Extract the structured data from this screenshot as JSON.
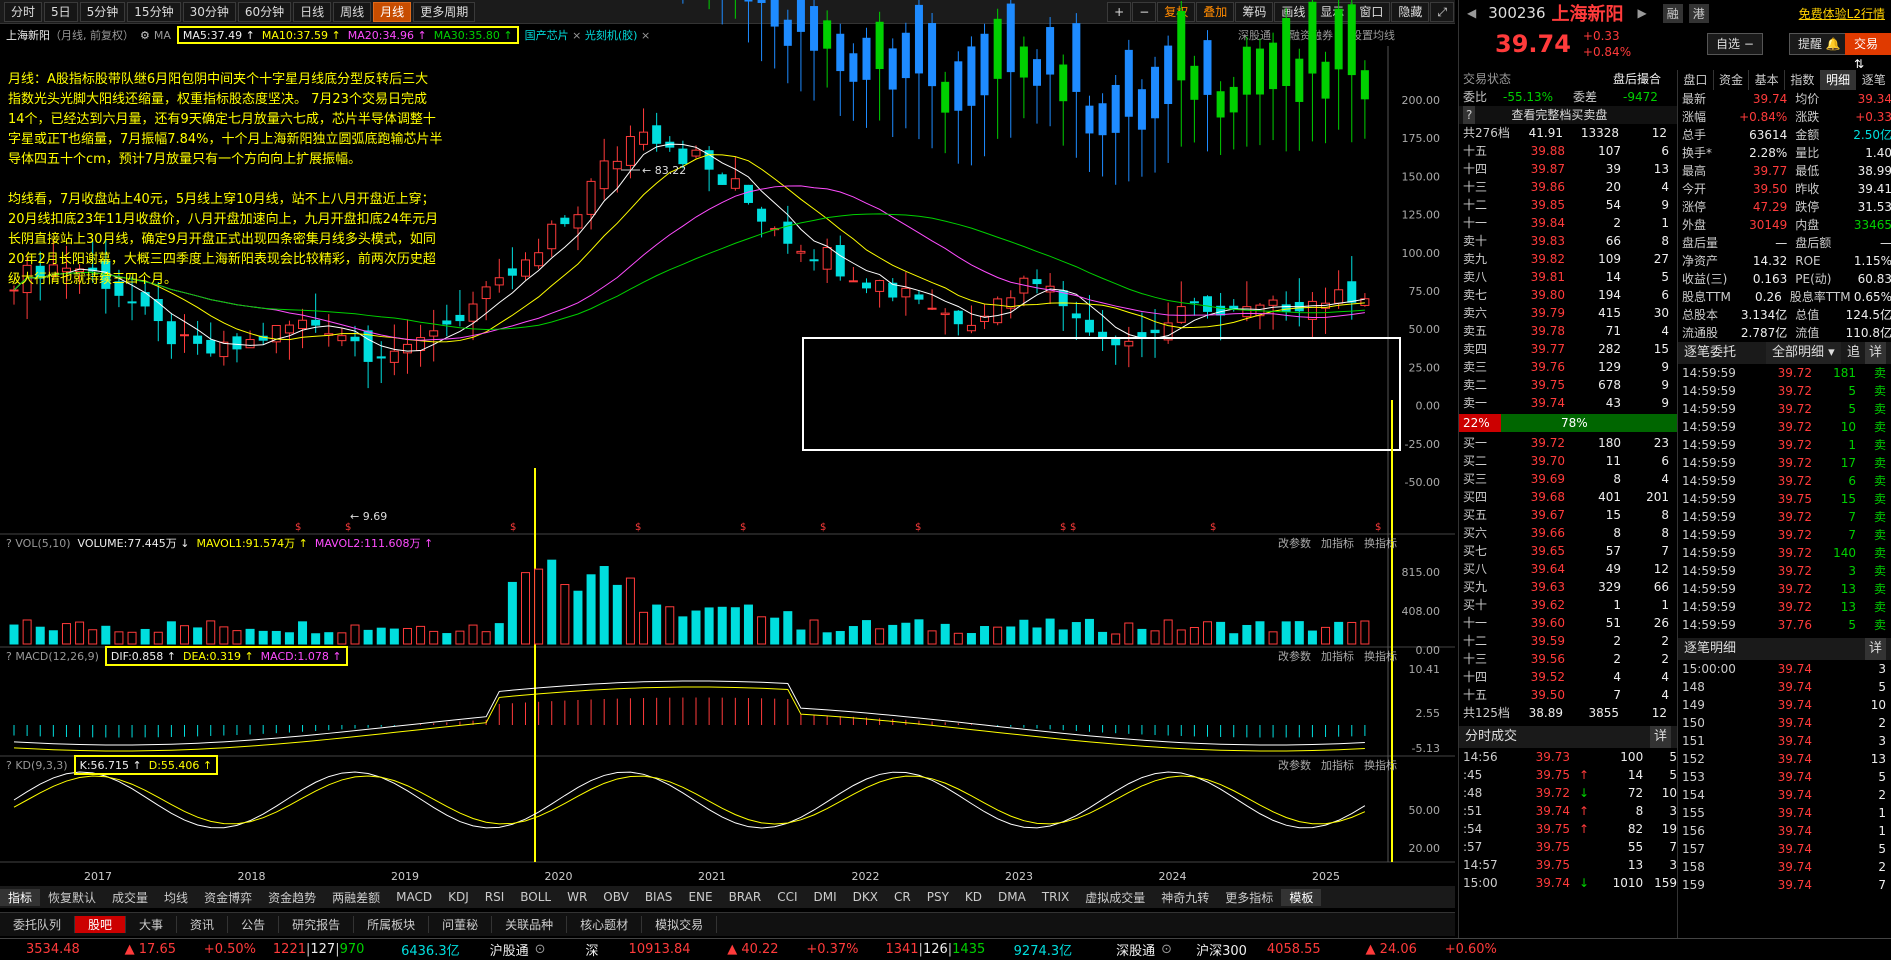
{
  "toolbar": {
    "periods": [
      "分时",
      "5日",
      "5分钟",
      "15分钟",
      "30分钟",
      "60分钟",
      "日线",
      "周线",
      "月线",
      "更多周期"
    ],
    "active": "月线",
    "right": [
      "+",
      "−",
      "复权",
      "叠加",
      "筹码",
      "画线",
      "显示",
      "窗口",
      "隐藏"
    ]
  },
  "chart_header": {
    "name": "上海新阳",
    "sub": "（月线, 前复权）",
    "ma_prefix": "MA",
    "ma5": "MA5:37.49 ↑",
    "ma10": "MA10:37.59 ↑",
    "ma20": "MA20:34.96 ↑",
    "ma30": "MA30:35.80 ↑",
    "tags": [
      "国产芯片",
      "光刻机(胶)"
    ],
    "links": [
      "深股通",
      "融资融券",
      "设置均线"
    ]
  },
  "note1": "月线：A股指标股带队继6月阳包阴中间夹个十字星月线底分型反转后三大\n指数光头光脚大阳线还缩量，权重指标股态度坚决。 7月23个交易日完成\n14个，已经达到六月量，还有9天确定七月放量六七成，芯片半导体调整十\n字星或正T也缩量，7月振幅7.84%，十个月上海新阳独立圆弧底跑输芯片半\n导体四五十个cm，预计7月放量只有一个方向向上扩展振幅。",
  "note2": "均线看，7月收盘站上40元，5月线上穿10月线，站不上八月开盘近上穿；\n20月线扣底23年11月收盘价，八月开盘加速向上，九月开盘扣底24年元月\n长阴直接站上30月线，确定9月开盘正式出现四条密集月线多头模式，如同\n20年2月长阳谢幕，大概三四季度上海新阳表现会比较精彩，前两次历史超\n级大行情也就持续三四个月。",
  "price_axis": [
    "200.00",
    "175.00",
    "150.00",
    "125.00",
    "100.00",
    "75.00",
    "50.00",
    "25.00",
    "0.00",
    "-25.00",
    "-50.00"
  ],
  "labels": {
    "high": "83.22",
    "low": "9.69"
  },
  "vol": {
    "title": "VOL(5,10)",
    "volume": "VOLUME:77.445万 ↓",
    "mavol1": "MAVOL1:91.574万 ↑",
    "mavol2": "MAVOL2:111.608万 ↑",
    "axis": [
      "815.00",
      "408.00",
      "0.00"
    ]
  },
  "macd": {
    "title": "MACD(12,26,9)",
    "dif": "DIF:0.858 ↑",
    "dea": "DEA:0.319 ↑",
    "macd": "MACD:1.078 ↑",
    "axis": [
      "10.41",
      "2.55",
      "-5.13"
    ]
  },
  "kd": {
    "title": "KD(9,3,3)",
    "k": "K:56.715 ↑",
    "d": "D:55.406 ↑",
    "axis": [
      "50.00",
      "20.00"
    ]
  },
  "ind_links": [
    "改参数",
    "加指标",
    "换指标"
  ],
  "years": [
    "2017",
    "2018",
    "2019",
    "2020",
    "2021",
    "2022",
    "2023",
    "2024",
    "2025"
  ],
  "func_tabs": [
    "指标",
    "恢复默认",
    "成交量",
    "均线",
    "资金博弈",
    "资金趋势",
    "两融差额",
    "MACD",
    "KDJ",
    "RSI",
    "BOLL",
    "WR",
    "OBV",
    "BIAS",
    "ENE",
    "BRAR",
    "CCI",
    "DMI",
    "DKX",
    "CR",
    "PSY",
    "KD",
    "DMA",
    "TRIX",
    "虚拟成交量",
    "神奇九转",
    "更多指标",
    "模板"
  ],
  "bottom_tabs": [
    "委托队列",
    "股吧",
    "大事",
    "资讯",
    "公告",
    "研究报告",
    "所属板块",
    "问董秘",
    "关联品种",
    "核心题材",
    "模拟交易"
  ],
  "status": {
    "sh": "3534.48",
    "sh_chg": "▲ 17.65",
    "sh_pct": "+0.50%",
    "sh_adv": "1221",
    "sh_flat": "127",
    "sh_dec": "970",
    "sh_amt": "6436.3亿",
    "hgt": "沪股通",
    "sz_label": "深",
    "sz": "10913.84",
    "sz_chg": "▲ 40.22",
    "sz_pct": "+0.37%",
    "sz_adv": "1341",
    "sz_flat": "126",
    "sz_dec": "1435",
    "sz_amt": "9274.3亿",
    "sgt": "深股通",
    "hs_label": "沪深300",
    "hs": "4058.55",
    "hs_chg": "▲ 24.06",
    "hs_pct": "+0.60%"
  },
  "stock": {
    "code": "300236",
    "name": "上海新阳",
    "price": "39.74",
    "chg": "+0.33",
    "pct": "+0.84%",
    "btns": [
      "融",
      "港"
    ],
    "free": "免费体验L2行情",
    "zx": "自选",
    "tx": "提醒",
    "jy": "交易"
  },
  "status_left": {
    "label": "交易状态",
    "val": "盘后撮合",
    "wb_label": "委比",
    "wb": "-55.13%",
    "wc_label": "委差",
    "wc": "-9472",
    "full": "查看完整档买卖盘",
    "total_label": "共276档",
    "total_price": "41.91",
    "total_vol": "13328",
    "total_n": "12"
  },
  "asks": [
    [
      "十五",
      "39.88",
      "107",
      "6"
    ],
    [
      "十四",
      "39.87",
      "39",
      "13"
    ],
    [
      "十三",
      "39.86",
      "20",
      "4"
    ],
    [
      "十二",
      "39.85",
      "54",
      "9"
    ],
    [
      "十一",
      "39.84",
      "2",
      "1"
    ],
    [
      "卖十",
      "39.83",
      "66",
      "8"
    ],
    [
      "卖九",
      "39.82",
      "109",
      "27"
    ],
    [
      "卖八",
      "39.81",
      "14",
      "5"
    ],
    [
      "卖七",
      "39.80",
      "194",
      "6"
    ],
    [
      "卖六",
      "39.79",
      "415",
      "30"
    ],
    [
      "卖五",
      "39.78",
      "71",
      "4"
    ],
    [
      "卖四",
      "39.77",
      "282",
      "15"
    ],
    [
      "卖三",
      "39.76",
      "129",
      "9"
    ],
    [
      "卖二",
      "39.75",
      "678",
      "9"
    ],
    [
      "卖一",
      "39.74",
      "43",
      "9"
    ]
  ],
  "ratio": {
    "left": "22%",
    "right": "78%"
  },
  "bids": [
    [
      "买一",
      "39.72",
      "180",
      "23"
    ],
    [
      "买二",
      "39.70",
      "11",
      "6"
    ],
    [
      "买三",
      "39.69",
      "8",
      "4"
    ],
    [
      "买四",
      "39.68",
      "401",
      "201"
    ],
    [
      "买五",
      "39.67",
      "15",
      "8"
    ],
    [
      "买六",
      "39.66",
      "8",
      "8"
    ],
    [
      "买七",
      "39.65",
      "57",
      "7"
    ],
    [
      "买八",
      "39.64",
      "49",
      "12"
    ],
    [
      "买九",
      "39.63",
      "329",
      "66"
    ],
    [
      "买十",
      "39.62",
      "1",
      "1"
    ],
    [
      "十一",
      "39.60",
      "51",
      "26"
    ],
    [
      "十二",
      "39.59",
      "2",
      "2"
    ],
    [
      "十三",
      "39.56",
      "2",
      "2"
    ],
    [
      "十四",
      "39.52",
      "4",
      "4"
    ],
    [
      "十五",
      "39.50",
      "7",
      "4"
    ]
  ],
  "bid_total": {
    "label": "共125档",
    "price": "38.89",
    "vol": "3855",
    "n": "12"
  },
  "side_tabs": [
    "盘口",
    "资金",
    "基本",
    "指数",
    "明细",
    "逐笔"
  ],
  "stats": [
    [
      "最新",
      "39.74",
      "均价",
      "39.34"
    ],
    [
      "涨幅",
      "+0.84%",
      "涨跌",
      "+0.33"
    ],
    [
      "总手",
      "63614",
      "金额",
      "2.50亿"
    ],
    [
      "换手*",
      "2.28%",
      "量比",
      "1.40"
    ],
    [
      "最高",
      "39.77",
      "最低",
      "38.99"
    ],
    [
      "今开",
      "39.50",
      "昨收",
      "39.41"
    ],
    [
      "涨停",
      "47.29",
      "跌停",
      "31.53"
    ],
    [
      "外盘",
      "30149",
      "内盘",
      "33465"
    ],
    [
      "盘后量",
      "—",
      "盘后额",
      "—"
    ],
    [
      "净资产",
      "14.32",
      "ROE",
      "1.15%"
    ],
    [
      "收益(三)",
      "0.163",
      "PE(动)",
      "60.83"
    ],
    [
      "股息TTM",
      "0.26",
      "股息率TTM",
      "0.65%"
    ],
    [
      "总股本",
      "3.134亿",
      "总值",
      "124.5亿"
    ],
    [
      "流通股",
      "2.787亿",
      "流值",
      "110.8亿"
    ]
  ],
  "zbwt": {
    "title": "逐笔委托",
    "sel": "全部明细",
    "btns": [
      "追",
      "详"
    ]
  },
  "zbwt_rows": [
    [
      "14:59:59",
      "39.72",
      "181",
      "卖"
    ],
    [
      "14:59:59",
      "39.72",
      "5",
      "卖"
    ],
    [
      "14:59:59",
      "39.72",
      "5",
      "卖"
    ],
    [
      "14:59:59",
      "39.72",
      "10",
      "卖"
    ],
    [
      "14:59:59",
      "39.72",
      "1",
      "卖"
    ],
    [
      "14:59:59",
      "39.72",
      "17",
      "卖"
    ],
    [
      "14:59:59",
      "39.72",
      "6",
      "卖"
    ],
    [
      "14:59:59",
      "39.75",
      "15",
      "卖"
    ],
    [
      "14:59:59",
      "39.72",
      "7",
      "卖"
    ],
    [
      "14:59:59",
      "39.72",
      "7",
      "卖"
    ],
    [
      "14:59:59",
      "39.72",
      "140",
      "卖"
    ],
    [
      "14:59:59",
      "39.72",
      "3",
      "卖"
    ],
    [
      "14:59:59",
      "39.72",
      "13",
      "卖"
    ],
    [
      "14:59:59",
      "39.72",
      "13",
      "卖"
    ],
    [
      "14:59:59",
      "37.76",
      "5",
      "卖"
    ]
  ],
  "zbmx": {
    "title": "逐笔明细",
    "btn": "详"
  },
  "zbmx_rows": [
    [
      "15:00:00",
      "39.74",
      "3"
    ],
    [
      "148",
      "39.74",
      "5"
    ],
    [
      "149",
      "39.74",
      "10"
    ],
    [
      "150",
      "39.74",
      "2"
    ],
    [
      "151",
      "39.74",
      "3"
    ],
    [
      "152",
      "39.74",
      "13"
    ],
    [
      "153",
      "39.74",
      "5"
    ],
    [
      "154",
      "39.74",
      "2"
    ],
    [
      "155",
      "39.74",
      "1"
    ],
    [
      "156",
      "39.74",
      "1"
    ],
    [
      "157",
      "39.74",
      "5"
    ],
    [
      "158",
      "39.74",
      "2"
    ],
    [
      "159",
      "39.74",
      "7"
    ]
  ],
  "fscj": {
    "title": "分时成交",
    "btn": "详"
  },
  "fscj_rows": [
    [
      "14:56",
      "39.73",
      "",
      "100",
      "5"
    ],
    [
      ":45",
      "39.75",
      "↑",
      "14",
      "5"
    ],
    [
      ":48",
      "39.72",
      "↓",
      "72",
      "10"
    ],
    [
      ":51",
      "39.74",
      "↑",
      "8",
      "3"
    ],
    [
      ":54",
      "39.75",
      "↑",
      "82",
      "19"
    ],
    [
      ":57",
      "39.75",
      "",
      "55",
      "7"
    ],
    [
      "14:57",
      "39.75",
      "",
      "13",
      "3"
    ],
    [
      "15:00",
      "39.74",
      "↓",
      "1010",
      "159"
    ]
  ]
}
